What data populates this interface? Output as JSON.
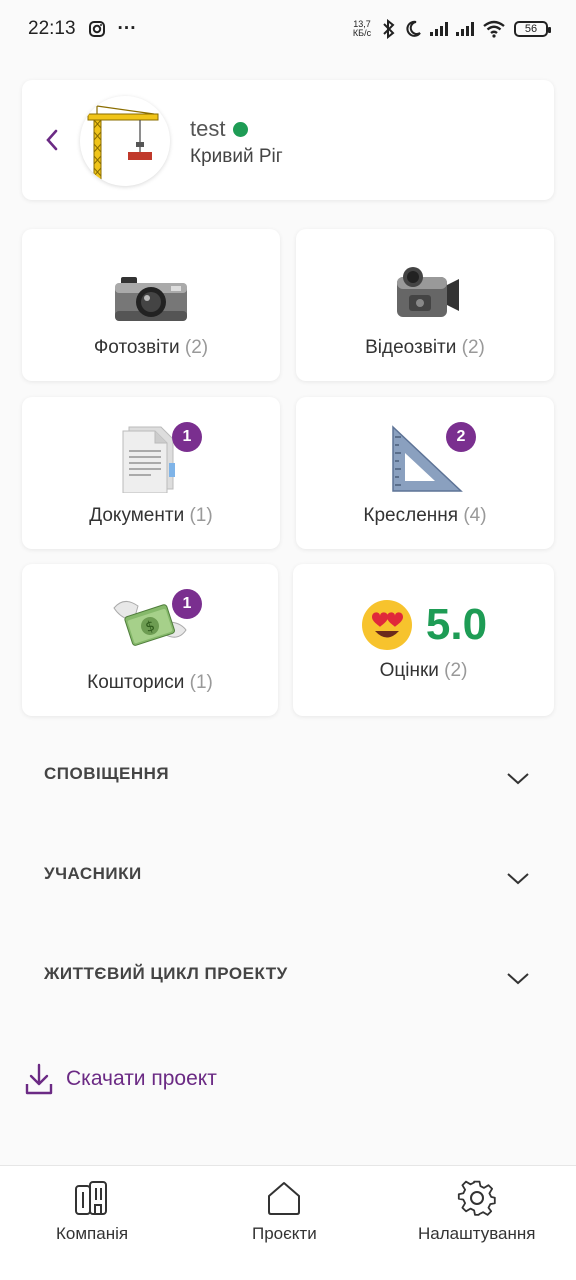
{
  "status_bar": {
    "time": "22:13",
    "more": "···",
    "net_speed_value": "13,7",
    "net_speed_unit": "КБ/с",
    "battery": "56",
    "icons": [
      "instagram-icon",
      "bluetooth-icon",
      "moon-icon",
      "signal-icon",
      "wifi-icon",
      "battery-icon"
    ]
  },
  "header": {
    "back": "‹",
    "project_name": "test",
    "city": "Кривий Ріг",
    "online_color": "#1e9c55"
  },
  "tiles": {
    "photo": {
      "label": "Фотозвіти",
      "count": "(2)",
      "icon": "camera-icon"
    },
    "video": {
      "label": "Відеозвіти",
      "count": "(2)",
      "icon": "video-camera-icon"
    },
    "docs": {
      "label": "Документи",
      "count": "(1)",
      "badge": "1",
      "icon": "document-icon"
    },
    "drawings": {
      "label": "Креслення",
      "count": "(4)",
      "badge": "2",
      "icon": "triangle-ruler-icon"
    },
    "estimates": {
      "label": "Кошториси",
      "count": "(1)",
      "badge": "1",
      "icon": "money-wings-icon"
    },
    "ratings": {
      "label": "Оцінки",
      "count": "(2)",
      "value": "5.0",
      "icon": "heart-eyes-emoji-icon"
    }
  },
  "accordions": [
    {
      "title": "СПОВІЩЕННЯ"
    },
    {
      "title": "УЧАСНИКИ"
    },
    {
      "title": "ЖИТТЄВИЙ ЦИКЛ ПРОЕКТУ"
    }
  ],
  "download": {
    "label": "Скачати проект"
  },
  "nav": {
    "company": "Компанія",
    "projects": "Проєкти",
    "settings": "Налаштування"
  },
  "colors": {
    "accent": "#6b2a84",
    "badge": "#7a2f8f",
    "rating": "#1e9c55"
  }
}
